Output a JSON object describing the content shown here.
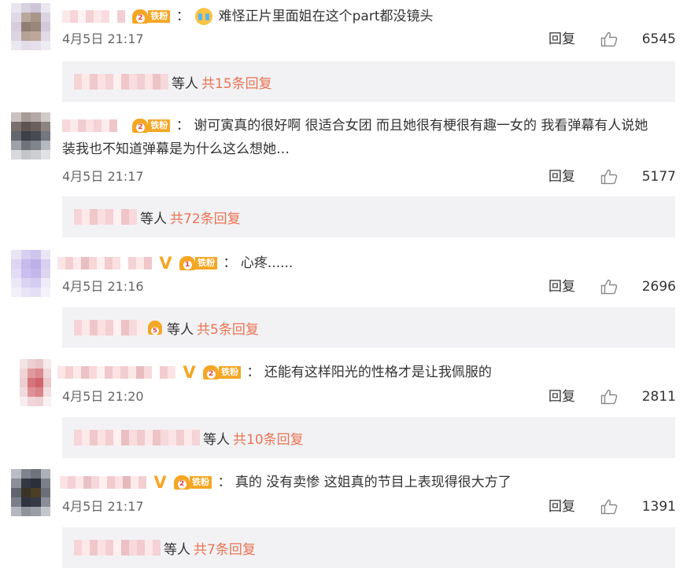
{
  "colors": {
    "accent": "#eb7350",
    "fan_badge": "#f5a623",
    "reply_box": "#f2f2f5"
  },
  "comments": [
    {
      "fan_level": "2",
      "fan_label": "铁粉",
      "verified": false,
      "emoji": "crying-face",
      "text": "难怪正片里面姐在这个part都没镜头",
      "text_line2": "",
      "time": "4月5日 21:17",
      "reply_label": "回复",
      "likes": "6545",
      "sub_crown_level": "",
      "sub_deng": "等人",
      "sub_total": "共15条回复"
    },
    {
      "fan_level": "2",
      "fan_label": "铁粉",
      "verified": false,
      "emoji": "",
      "text": "谢可寅真的很好啊 很适合女团 而且她很有梗很有趣一女的  我看弹幕有人说她",
      "text_line2": "装我也不知道弹幕是为什么这么想她…",
      "time": "4月5日 21:17",
      "reply_label": "回复",
      "likes": "5177",
      "sub_crown_level": "",
      "sub_deng": "等人",
      "sub_total": "共72条回复"
    },
    {
      "fan_level": "1",
      "fan_label": "铁粉",
      "verified": true,
      "emoji": "",
      "text": "心疼......",
      "text_line2": "",
      "time": "4月5日 21:16",
      "reply_label": "回复",
      "likes": "2696",
      "sub_crown_level": "5",
      "sub_deng": "等人",
      "sub_total": "共5条回复"
    },
    {
      "fan_level": "2",
      "fan_label": "铁粉",
      "verified": true,
      "emoji": "",
      "text": "还能有这样阳光的性格才是让我佩服的",
      "text_line2": "",
      "time": "4月5日 21:20",
      "reply_label": "回复",
      "likes": "2811",
      "sub_crown_level": "",
      "sub_deng": "等人",
      "sub_total": "共10条回复"
    },
    {
      "fan_level": "2",
      "fan_label": "铁粉",
      "verified": true,
      "emoji": "",
      "text": "真的 没有卖惨 这姐真的节目上表现得很大方了",
      "text_line2": "",
      "time": "4月5日 21:17",
      "reply_label": "回复",
      "likes": "1391",
      "sub_crown_level": "",
      "sub_deng": "等人",
      "sub_total": "共7条回复"
    }
  ]
}
